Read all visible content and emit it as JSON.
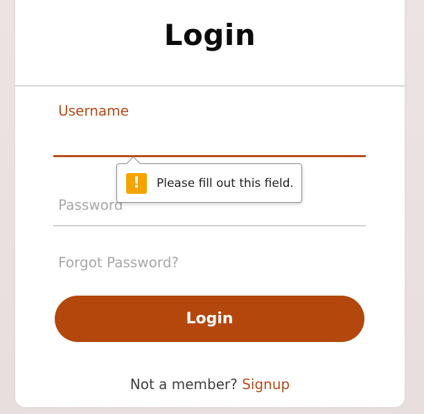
{
  "form": {
    "title": "Login",
    "username_label": "Username",
    "password_placeholder": "Password",
    "forgot_link": "Forgot Password?",
    "login_button": "Login",
    "signup_prompt": "Not a member?",
    "signup_link": "Signup"
  },
  "validation_tooltip": {
    "message": "Please fill out this field.",
    "icon": "warning-exclamation-icon"
  },
  "colors": {
    "accent": "#b84a1a",
    "button": "#b4470c",
    "warning": "#f5a300"
  }
}
